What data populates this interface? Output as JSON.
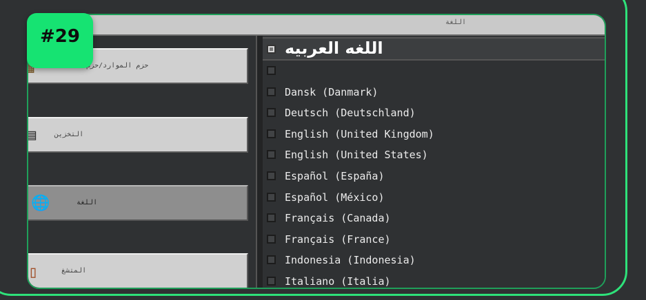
{
  "header": {
    "title": "اللغة"
  },
  "badge": {
    "text": "#29"
  },
  "sidebar": {
    "items": [
      {
        "label": "حزم الموارد/حزم",
        "icon": "package-icon",
        "selected": false
      },
      {
        "label": "التخزين",
        "icon": "storage-icon",
        "selected": false
      },
      {
        "label": "اللغة",
        "icon": "globe-icon",
        "selected": true
      },
      {
        "label": "المتشغ",
        "icon": "door-icon",
        "selected": false
      }
    ]
  },
  "languages": {
    "selected_label": "اللغه العربيه",
    "items": [
      {
        "label": ""
      },
      {
        "label": "Dansk (Danmark)"
      },
      {
        "label": "Deutsch (Deutschland)"
      },
      {
        "label": "English (United Kingdom)"
      },
      {
        "label": "English (United States)"
      },
      {
        "label": "Español (España)"
      },
      {
        "label": "Español (México)"
      },
      {
        "label": "Français (Canada)"
      },
      {
        "label": "Français (France)"
      },
      {
        "label": "Indonesia (Indonesia)"
      },
      {
        "label": "Italiano (Italia)"
      }
    ]
  },
  "colors": {
    "accent": "#16e372",
    "frame": "#2ee27a"
  }
}
